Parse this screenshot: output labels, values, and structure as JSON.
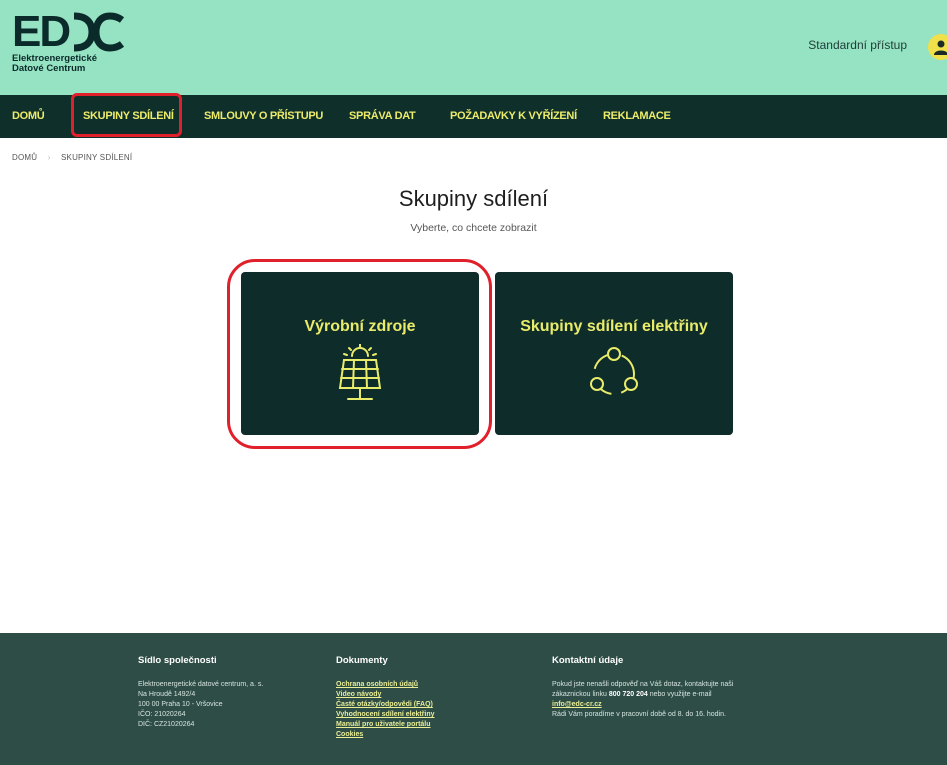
{
  "header": {
    "logo_text": "EDC",
    "logo_sub_line1": "Elektroenergetické",
    "logo_sub_line2": "Datové Centrum",
    "access_label": "Standardní přístup"
  },
  "nav": {
    "items": [
      {
        "label": "DOMŮ"
      },
      {
        "label": "SKUPINY SDÍLENÍ"
      },
      {
        "label": "SMLOUVY O PŘÍSTUPU"
      },
      {
        "label": "SPRÁVA DAT"
      },
      {
        "label": "POŽADAVKY K VYŘÍZENÍ"
      },
      {
        "label": "REKLAMACE"
      }
    ]
  },
  "breadcrumb": {
    "home": "DOMŮ",
    "current": "SKUPINY SDÍLENÍ"
  },
  "page": {
    "title": "Skupiny sdílení",
    "subtitle": "Vyberte, co chcete zobrazit"
  },
  "cards": [
    {
      "title": "Výrobní zdroje",
      "icon": "solar-panel-icon"
    },
    {
      "title": "Skupiny sdílení elektřiny",
      "icon": "sharing-group-icon"
    }
  ],
  "footer": {
    "company": {
      "heading": "Sídlo společnosti",
      "lines": [
        "Elektroenergetické datové centrum, a. s.",
        "Na Hroudě 1492/4",
        "100 00 Praha 10 - Vršovice",
        "IČO: 21020264",
        "DIČ: CZ21020264"
      ]
    },
    "documents": {
      "heading": "Dokumenty",
      "links": [
        "Ochrana osobních údajů",
        "Video návody",
        "Časté otázky/odpovědi (FAQ)",
        "Vyhodnocení sdílení elektřiny",
        "Manuál pro uživatele portálu",
        "Cookies"
      ]
    },
    "contact": {
      "heading": "Kontaktní údaje",
      "line1": "Pokud jste nenašli odpověď na Váš dotaz, kontaktujte naši",
      "line2_pre": "zákaznickou linku",
      "phone": "800 720 204",
      "line2_post": "nebo využijte e-mail",
      "email": "info@edc-cr.cz",
      "line3": "Rádi Vám poradíme v pracovní době od 8. do 16. hodin."
    }
  },
  "colors": {
    "header_bg": "#96e3c3",
    "nav_bg": "#0f2f2b",
    "nav_text": "#ecec6a",
    "card_bg": "#0e2c2a",
    "card_text": "#e9ec6a",
    "footer_bg": "#2f4d47",
    "highlight": "#e0202a"
  }
}
